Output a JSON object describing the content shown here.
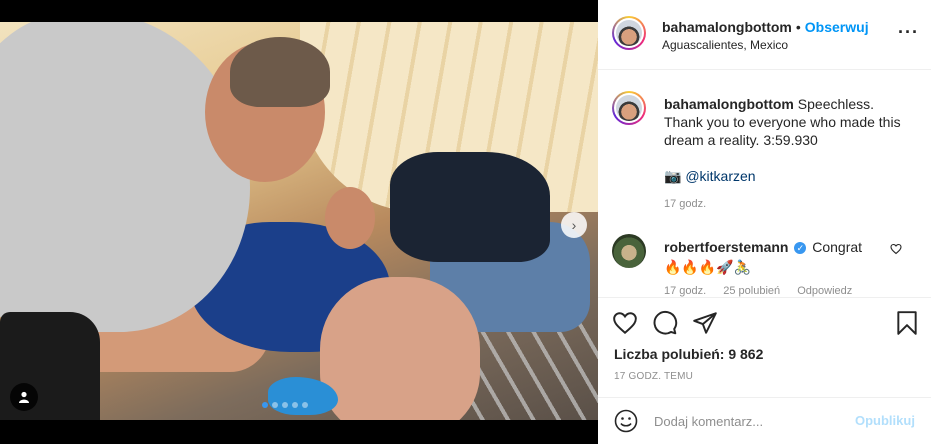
{
  "post": {
    "username": "bahamalongbottom",
    "separator": "•",
    "follow_label": "Obserwuj",
    "location": "Aguascalientes, Mexico",
    "more_label": "···"
  },
  "caption": {
    "username": "bahamalongbottom",
    "line1": "Speechless.",
    "line2": "Thank you to everyone who made this",
    "line3": "dream a reality. 3:59.930",
    "credit_icon": "📷",
    "credit_handle": "@kitkarzen",
    "time": "17 godz."
  },
  "comment": {
    "username": "robertfoerstemann",
    "text": "Congrat",
    "emojis": "🔥🔥🔥🚀🚴",
    "time": "17 godz.",
    "likes": "25 polubień",
    "reply": "Odpowiedz"
  },
  "actions": {
    "likes_label": "Liczba polubień: 9 862",
    "post_time": "17 GODZ. TEMU"
  },
  "add_comment": {
    "placeholder": "Dodaj komentarz...",
    "publish_label": "Opublikuj"
  },
  "carousel": {
    "next_label": "›",
    "slide_count": 5,
    "active_index": 0
  },
  "colors": {
    "accent": "#0095f6",
    "publish_disabled": "#b2dffc",
    "verified": "#3897f0"
  },
  "icons": [
    "heart-icon",
    "comment-icon",
    "share-icon",
    "bookmark-icon",
    "emoji-icon",
    "user-tag-icon",
    "verified-icon",
    "more-icon"
  ]
}
